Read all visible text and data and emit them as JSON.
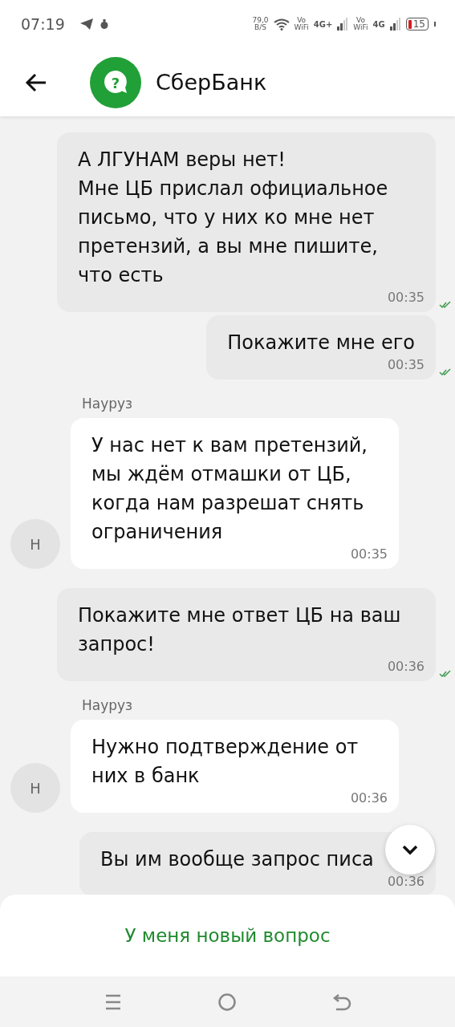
{
  "status_bar": {
    "time": "07:19",
    "speed": "79,0",
    "speed_unit": "B/S",
    "sim1_vo": "Vo",
    "sim1_wifi": "WiFi",
    "sim1_net": "4G+",
    "sim2_vo": "Vo",
    "sim2_wifi": "WiFi",
    "sim2_net": "4G",
    "battery": "15"
  },
  "header": {
    "logo_glyph": "?",
    "title": "СберБанк"
  },
  "messages": [
    {
      "kind": "out",
      "text": "А ЛГУНАМ веры нет!\nМне ЦБ прислал официальное письмо, что у них ко мне нет претензий, а вы мне пишите, что есть",
      "time": "00:35",
      "read": true
    },
    {
      "kind": "out",
      "text": "Покажите мне его",
      "time": "00:35",
      "read": true
    },
    {
      "kind": "in",
      "sender": "Науруз",
      "avatar": "Н",
      "text": "У нас нет к вам претензий, мы ждём отмашки от ЦБ, когда нам разрешат снять ограничения",
      "time": "00:35"
    },
    {
      "kind": "out",
      "text": "Покажите мне ответ ЦБ на ваш запрос!",
      "time": "00:36",
      "read": true
    },
    {
      "kind": "in",
      "sender": "Науруз",
      "avatar": "Н",
      "text": "Нужно подтверждение от них в банк",
      "time": "00:36"
    },
    {
      "kind": "out",
      "text": "Вы им вообще запрос писа",
      "time": "00:36"
    }
  ],
  "bottom_sheet": {
    "button": "У меня новый вопрос"
  }
}
